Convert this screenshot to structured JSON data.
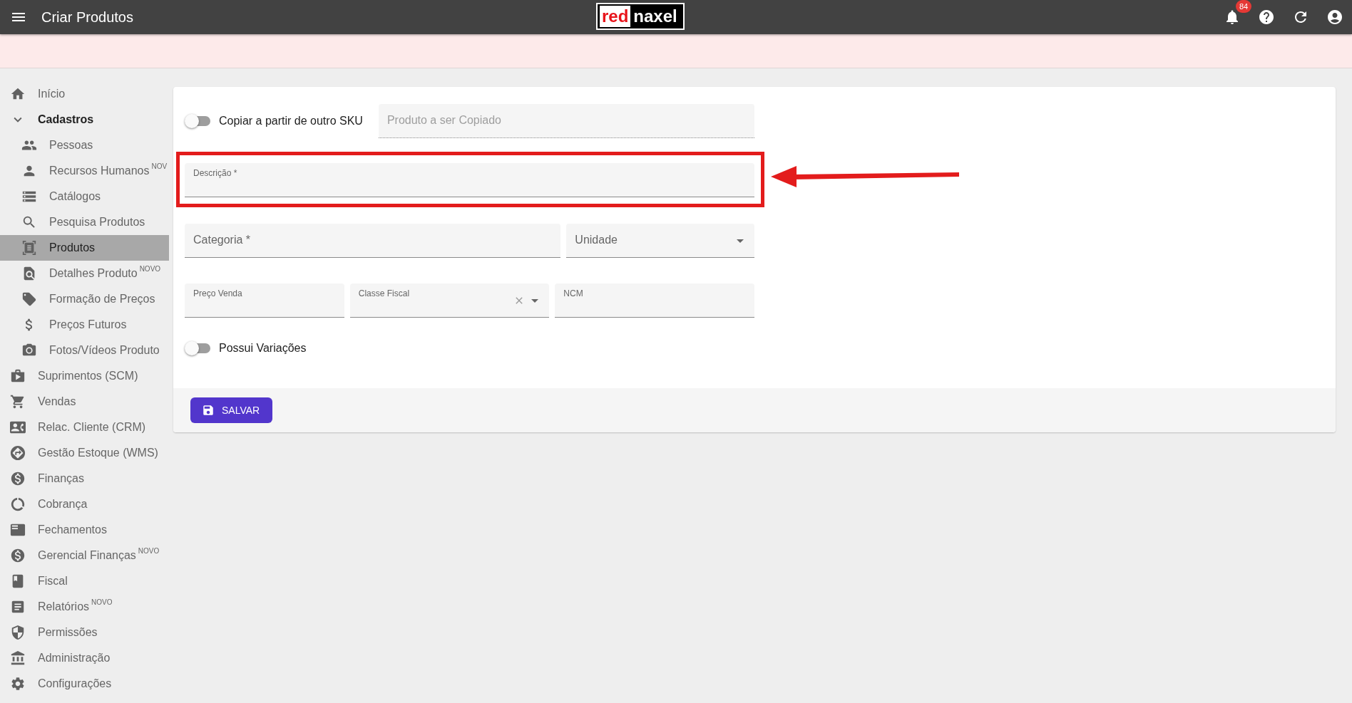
{
  "app_bar": {
    "title": "Criar Produtos",
    "logo": {
      "part_1": "red",
      "part_2": "naxel"
    },
    "notification_count": "84"
  },
  "sidebar": {
    "items": [
      {
        "label": "Início",
        "selected": false
      },
      {
        "label": "Cadastros",
        "selected": false,
        "expanded": true,
        "children": [
          {
            "label": "Pessoas",
            "selected": false
          },
          {
            "label": "Recursos Humanos",
            "badge": "NOV",
            "selected": false
          },
          {
            "label": "Catálogos",
            "selected": false
          },
          {
            "label": "Pesquisa Produtos",
            "selected": false
          },
          {
            "label": "Produtos",
            "selected": true
          },
          {
            "label": "Detalhes Produto",
            "badge": "NOVO",
            "selected": false
          },
          {
            "label": "Formação de Preços",
            "selected": false
          },
          {
            "label": "Preços Futuros",
            "selected": false
          },
          {
            "label": "Fotos/Vídeos Produto",
            "selected": false
          }
        ]
      },
      {
        "label": "Suprimentos (SCM)",
        "selected": false
      },
      {
        "label": "Vendas",
        "selected": false
      },
      {
        "label": "Relac. Cliente (CRM)",
        "selected": false
      },
      {
        "label": "Gestão Estoque (WMS)",
        "selected": false
      },
      {
        "label": "Finanças",
        "selected": false
      },
      {
        "label": "Cobrança",
        "selected": false
      },
      {
        "label": "Fechamentos",
        "selected": false
      },
      {
        "label": "Gerencial Finanças",
        "badge": "NOVO",
        "selected": false
      },
      {
        "label": "Fiscal",
        "selected": false
      },
      {
        "label": "Relatórios",
        "badge": "NOVO",
        "selected": false
      },
      {
        "label": "Permissões",
        "selected": false
      },
      {
        "label": "Administração",
        "selected": false
      },
      {
        "label": "Configurações",
        "selected": false
      }
    ]
  },
  "form": {
    "rows": [
      [
        {
          "kind": "toggle",
          "label": "Copiar a partir de outro SKU",
          "on": false
        },
        {
          "kind": "text",
          "label": "Produto a ser Copiado",
          "floated": false,
          "disabled": true
        }
      ],
      [
        {
          "kind": "text",
          "label": "Descrição *",
          "floated": true,
          "highlighted": true
        }
      ],
      [
        {
          "kind": "text",
          "label": "Categoria *",
          "floated": false
        },
        {
          "kind": "select",
          "label": "Unidade",
          "floated": false
        }
      ],
      [
        {
          "kind": "text",
          "label": "Preço Venda",
          "floated": true
        },
        {
          "kind": "select",
          "label": "Classe Fiscal",
          "floated": true,
          "clearable": true
        },
        {
          "kind": "text",
          "label": "NCM",
          "floated": true
        }
      ],
      [
        {
          "kind": "toggle",
          "label": "Possui Variações",
          "on": false
        }
      ]
    ],
    "save_button": "SALVAR"
  }
}
